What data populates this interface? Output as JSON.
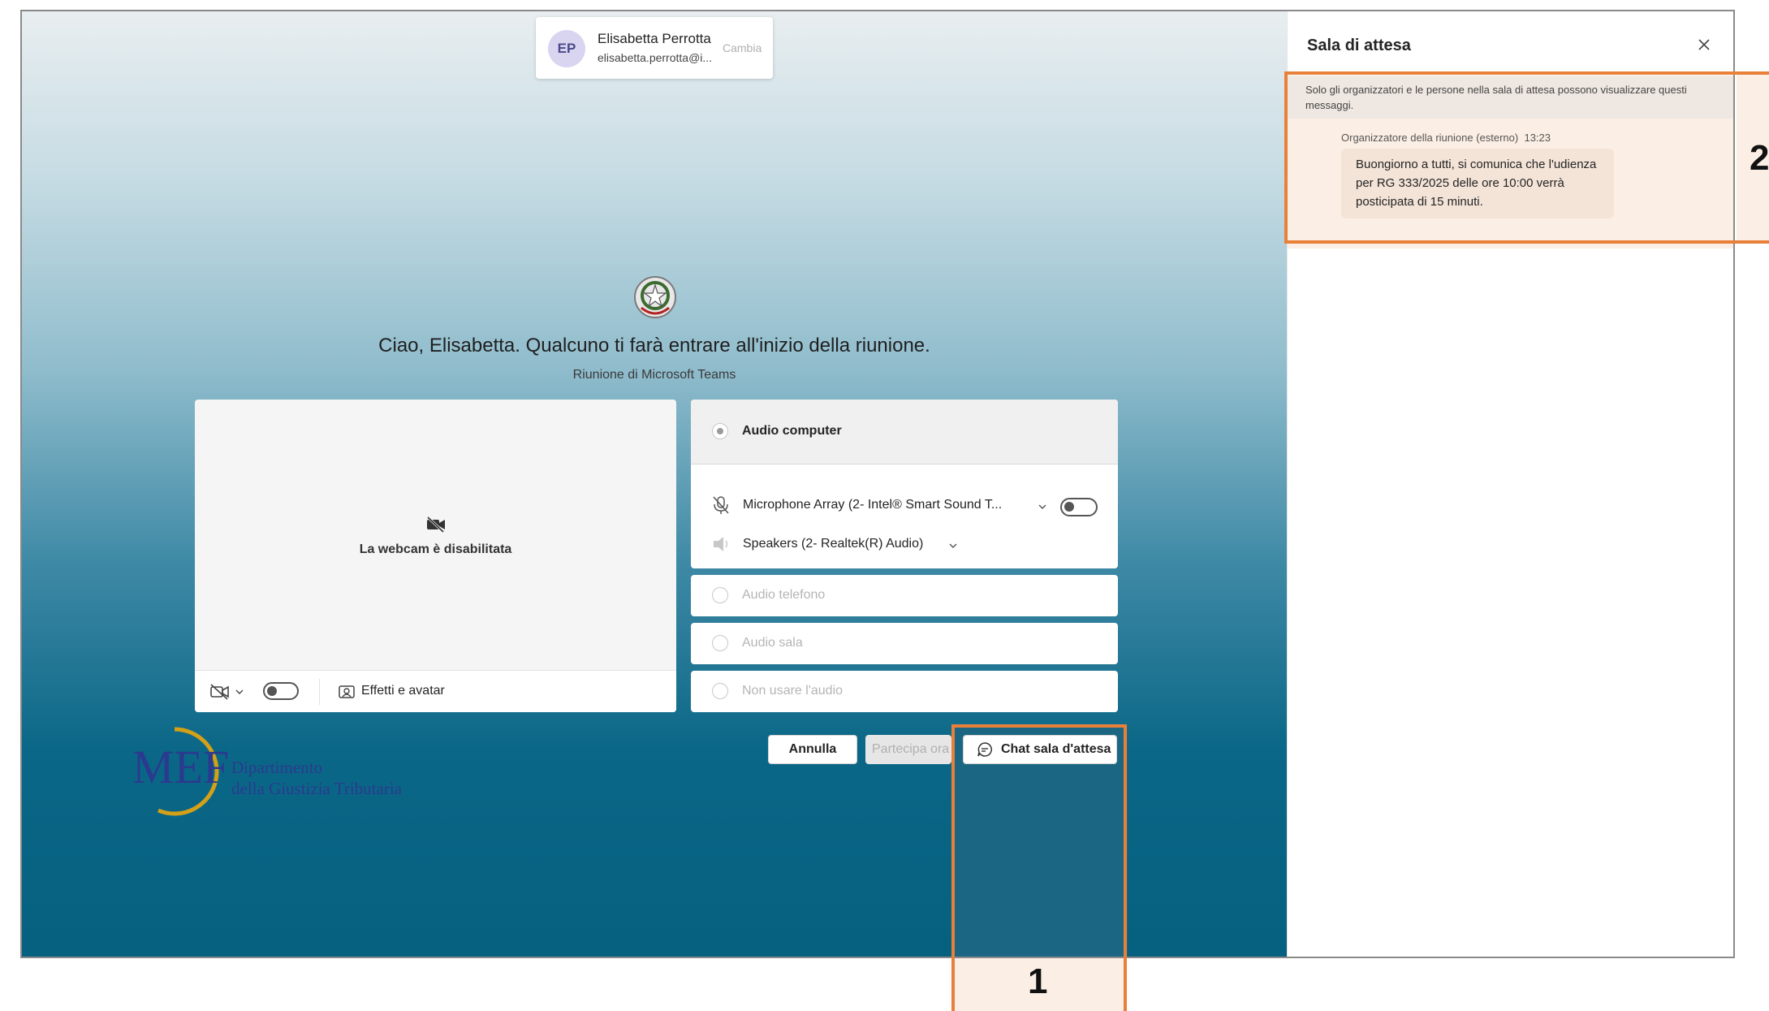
{
  "account": {
    "initials": "EP",
    "name": "Elisabetta Perrotta",
    "email": "elisabetta.perrotta@i...",
    "change_label": "Cambia"
  },
  "greeting": "Ciao, Elisabetta. Qualcuno ti farà entrare all'inizio della riunione.",
  "meeting_type": "Riunione di Microsoft Teams",
  "camera": {
    "disabled_text": "La webcam è disabilitata",
    "effects_label": "Effetti e avatar"
  },
  "audio": {
    "computer_label": "Audio computer",
    "microphone": "Microphone Array (2- Intel® Smart Sound T...",
    "speakers": "Speakers (2- Realtek(R) Audio)",
    "phone_label": "Audio telefono",
    "room_label": "Audio sala",
    "none_label": "Non usare l'audio"
  },
  "buttons": {
    "cancel": "Annulla",
    "join": "Partecipa ora",
    "chat": "Chat sala d'attesa"
  },
  "logo": {
    "text": "MEF",
    "line1": "Dipartimento",
    "line2": "della Giustizia Tributaria"
  },
  "chat_panel": {
    "title": "Sala di attesa",
    "notice": "Solo gli organizzatori e le persone nella sala di attesa possono visualizzare questi messaggi.",
    "sender": "Organizzatore della riunione (esterno)",
    "time": "13:23",
    "message": "Buongiorno a tutti, si comunica che l'udienza per RG 333/2025 delle ore 10:00 verrà posticipata di 15 minuti."
  },
  "annotations": {
    "one": "1",
    "two": "2"
  },
  "colors": {
    "highlight": "#e8803a",
    "highlight_fill": "#fbeee4"
  }
}
